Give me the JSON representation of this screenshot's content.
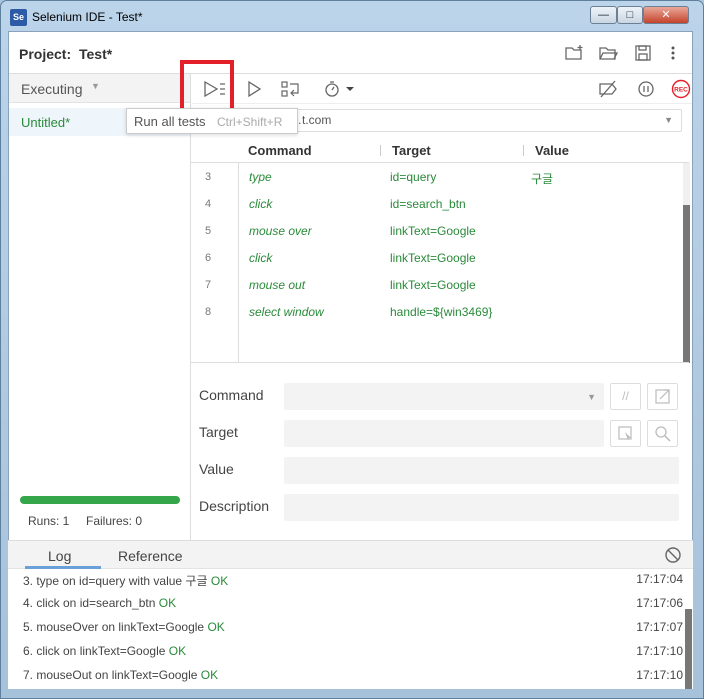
{
  "window": {
    "title": "Selenium IDE - Test*",
    "app_icon": "Se",
    "buttons": {
      "minimize": "—",
      "maximize": "□",
      "close": "✕"
    }
  },
  "header": {
    "project_label": "Project:",
    "project_name": "Test*"
  },
  "left": {
    "mode": "Executing",
    "tests": [
      "Untitled*"
    ],
    "runs": "Runs: 1",
    "failures": "Failures: 0"
  },
  "toolbar": {
    "tooltip_title": "Run all tests",
    "tooltip_shortcut": "Ctrl+Shift+R"
  },
  "url": {
    "value": "…t.com"
  },
  "table": {
    "headers": {
      "command": "Command",
      "target": "Target",
      "value": "Value"
    },
    "rows": [
      {
        "num": "3",
        "command": "type",
        "target": "id=query",
        "value": "구글"
      },
      {
        "num": "4",
        "command": "click",
        "target": "id=search_btn",
        "value": ""
      },
      {
        "num": "5",
        "command": "mouse over",
        "target": "linkText=Google",
        "value": ""
      },
      {
        "num": "6",
        "command": "click",
        "target": "linkText=Google",
        "value": ""
      },
      {
        "num": "7",
        "command": "mouse out",
        "target": "linkText=Google",
        "value": ""
      },
      {
        "num": "8",
        "command": "select window",
        "target": "handle=${win3469}",
        "value": ""
      }
    ]
  },
  "editor": {
    "command_label": "Command",
    "target_label": "Target",
    "value_label": "Value",
    "description_label": "Description",
    "comment_toggle": "//"
  },
  "log": {
    "tabs": {
      "log": "Log",
      "reference": "Reference"
    },
    "entries": [
      {
        "text": "3.  type on id=query with value 구글 ",
        "status": "OK",
        "time": "17:17:04"
      },
      {
        "text": "4.  click on id=search_btn ",
        "status": "OK",
        "time": "17:17:06"
      },
      {
        "text": "5.  mouseOver on linkText=Google ",
        "status": "OK",
        "time": "17:17:07"
      },
      {
        "text": "6.  click on linkText=Google ",
        "status": "OK",
        "time": "17:17:10"
      },
      {
        "text": "7.  mouseOut on linkText=Google ",
        "status": "OK",
        "time": "17:17:10"
      }
    ]
  },
  "colors": {
    "accent_green": "#2a8a3a",
    "progress": "#35a64a",
    "highlight_red": "#e3202a",
    "record_red": "#e3202a"
  }
}
